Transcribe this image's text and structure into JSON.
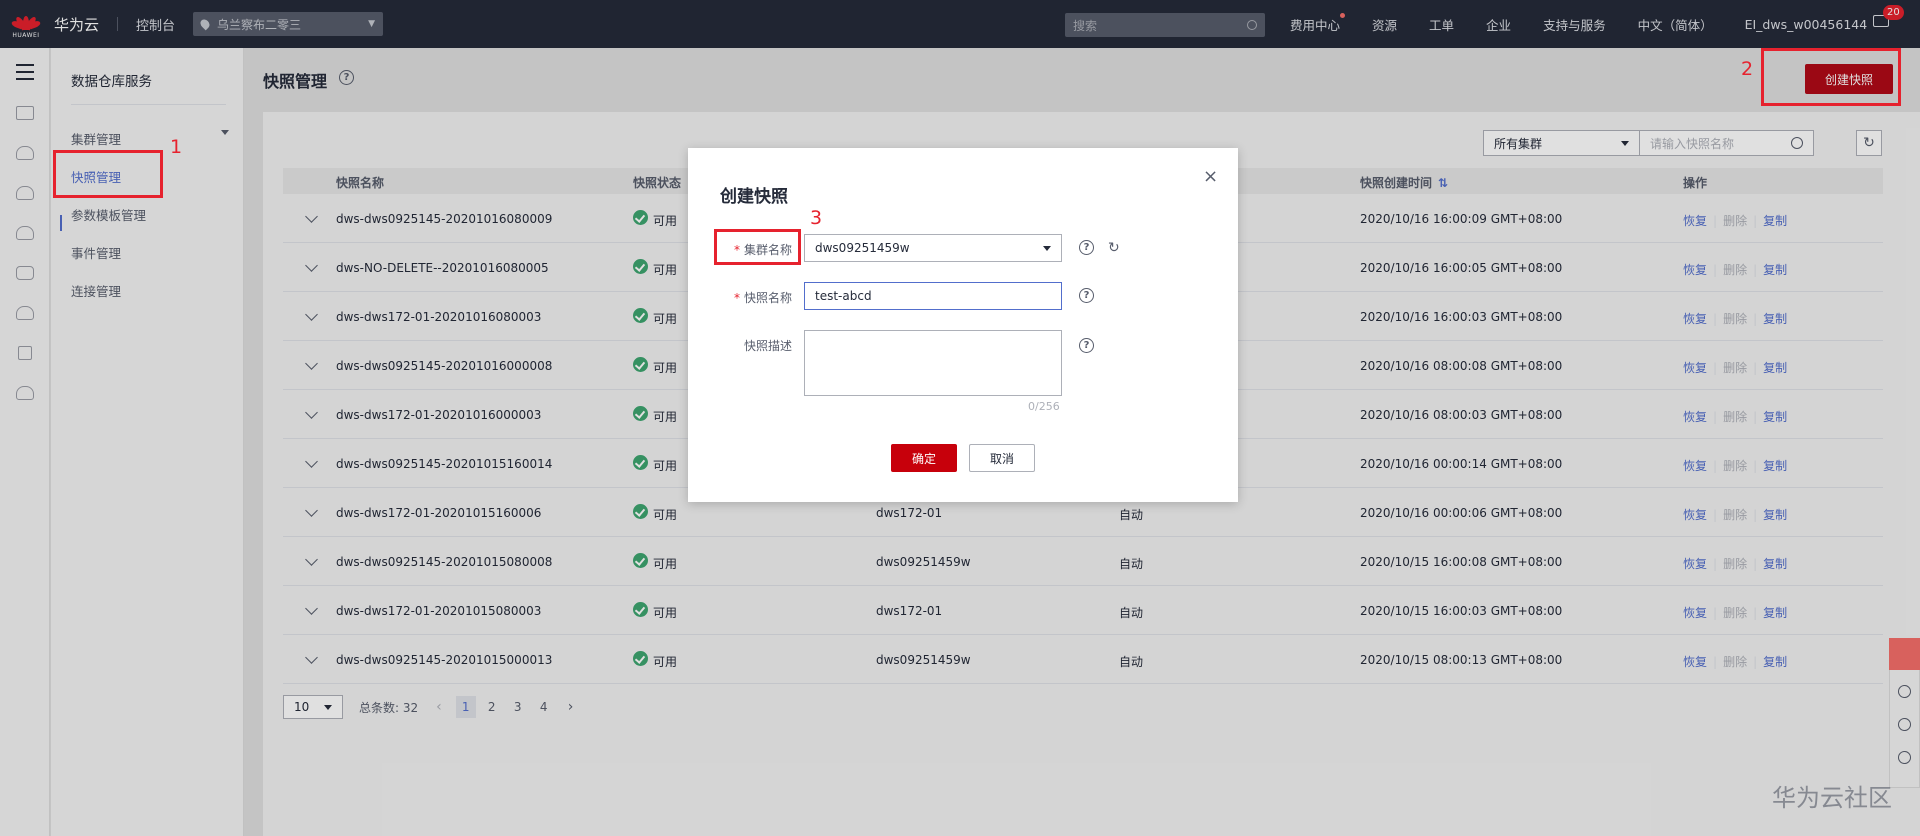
{
  "topbar": {
    "logo_text": "HUAWEI",
    "brand": "华为云",
    "console": "控制台",
    "region": "乌兰察布二零三",
    "search_placeholder": "搜索",
    "nav": [
      "费用中心",
      "资源",
      "工单",
      "企业",
      "支持与服务",
      "中文（简体）",
      "EI_dws_w00456144"
    ],
    "mail_badge": "20"
  },
  "sidebar": {
    "title": "数据仓库服务",
    "items": [
      "集群管理",
      "快照管理",
      "参数模板管理",
      "事件管理",
      "连接管理"
    ]
  },
  "main": {
    "title": "快照管理",
    "create_button": "创建快照",
    "filter_select": "所有集群",
    "search_placeholder": "请输入快照名称"
  },
  "table": {
    "headers": [
      "快照名称",
      "快照状态",
      "快照创建时间",
      "操作"
    ],
    "actions": [
      "恢复",
      "删除",
      "复制"
    ],
    "rows": [
      {
        "name": "dws-dws0925145-20201016080009",
        "status": "可用",
        "cluster": "",
        "type": "",
        "time": "2020/10/16 16:00:09 GMT+08:00"
      },
      {
        "name": "dws-NO-DELETE--20201016080005",
        "status": "可用",
        "cluster": "",
        "type": "",
        "time": "2020/10/16 16:00:05 GMT+08:00"
      },
      {
        "name": "dws-dws172-01-20201016080003",
        "status": "可用",
        "cluster": "",
        "type": "",
        "time": "2020/10/16 16:00:03 GMT+08:00"
      },
      {
        "name": "dws-dws0925145-20201016000008",
        "status": "可用",
        "cluster": "",
        "type": "",
        "time": "2020/10/16 08:00:08 GMT+08:00"
      },
      {
        "name": "dws-dws172-01-20201016000003",
        "status": "可用",
        "cluster": "",
        "type": "",
        "time": "2020/10/16 08:00:03 GMT+08:00"
      },
      {
        "name": "dws-dws0925145-20201015160014",
        "status": "可用",
        "cluster": "",
        "type": "",
        "time": "2020/10/16 00:00:14 GMT+08:00"
      },
      {
        "name": "dws-dws172-01-20201015160006",
        "status": "可用",
        "cluster": "dws172-01",
        "type": "自动",
        "time": "2020/10/16 00:00:06 GMT+08:00"
      },
      {
        "name": "dws-dws0925145-20201015080008",
        "status": "可用",
        "cluster": "dws09251459w",
        "type": "自动",
        "time": "2020/10/15 16:00:08 GMT+08:00"
      },
      {
        "name": "dws-dws172-01-20201015080003",
        "status": "可用",
        "cluster": "dws172-01",
        "type": "自动",
        "time": "2020/10/15 16:00:03 GMT+08:00"
      },
      {
        "name": "dws-dws0925145-20201015000013",
        "status": "可用",
        "cluster": "dws09251459w",
        "type": "自动",
        "time": "2020/10/15 08:00:13 GMT+08:00"
      }
    ]
  },
  "pager": {
    "size": "10",
    "total": "总条数: 32",
    "prev": "‹",
    "pages": [
      "1",
      "2",
      "3",
      "4"
    ],
    "next": "›"
  },
  "dialog": {
    "title": "创建快照",
    "close": "×",
    "required_mark": "*",
    "cluster_label": "集群名称",
    "cluster_value": "dws09251459w",
    "name_label": "快照名称",
    "name_value": "test-abcd",
    "desc_label": "快照描述",
    "desc_count": "0/256",
    "ok_label": "确定",
    "cancel_label": "取消",
    "help_glyph": "?",
    "refresh_glyph": "↻"
  },
  "annotations": [
    "1",
    "2",
    "3"
  ],
  "watermark": "华为云社区",
  "colors": {
    "accent": "#526ecc",
    "brand_red": "#c7000b",
    "annotation_red": "#e6222e",
    "ok_green": "#3ea570"
  }
}
